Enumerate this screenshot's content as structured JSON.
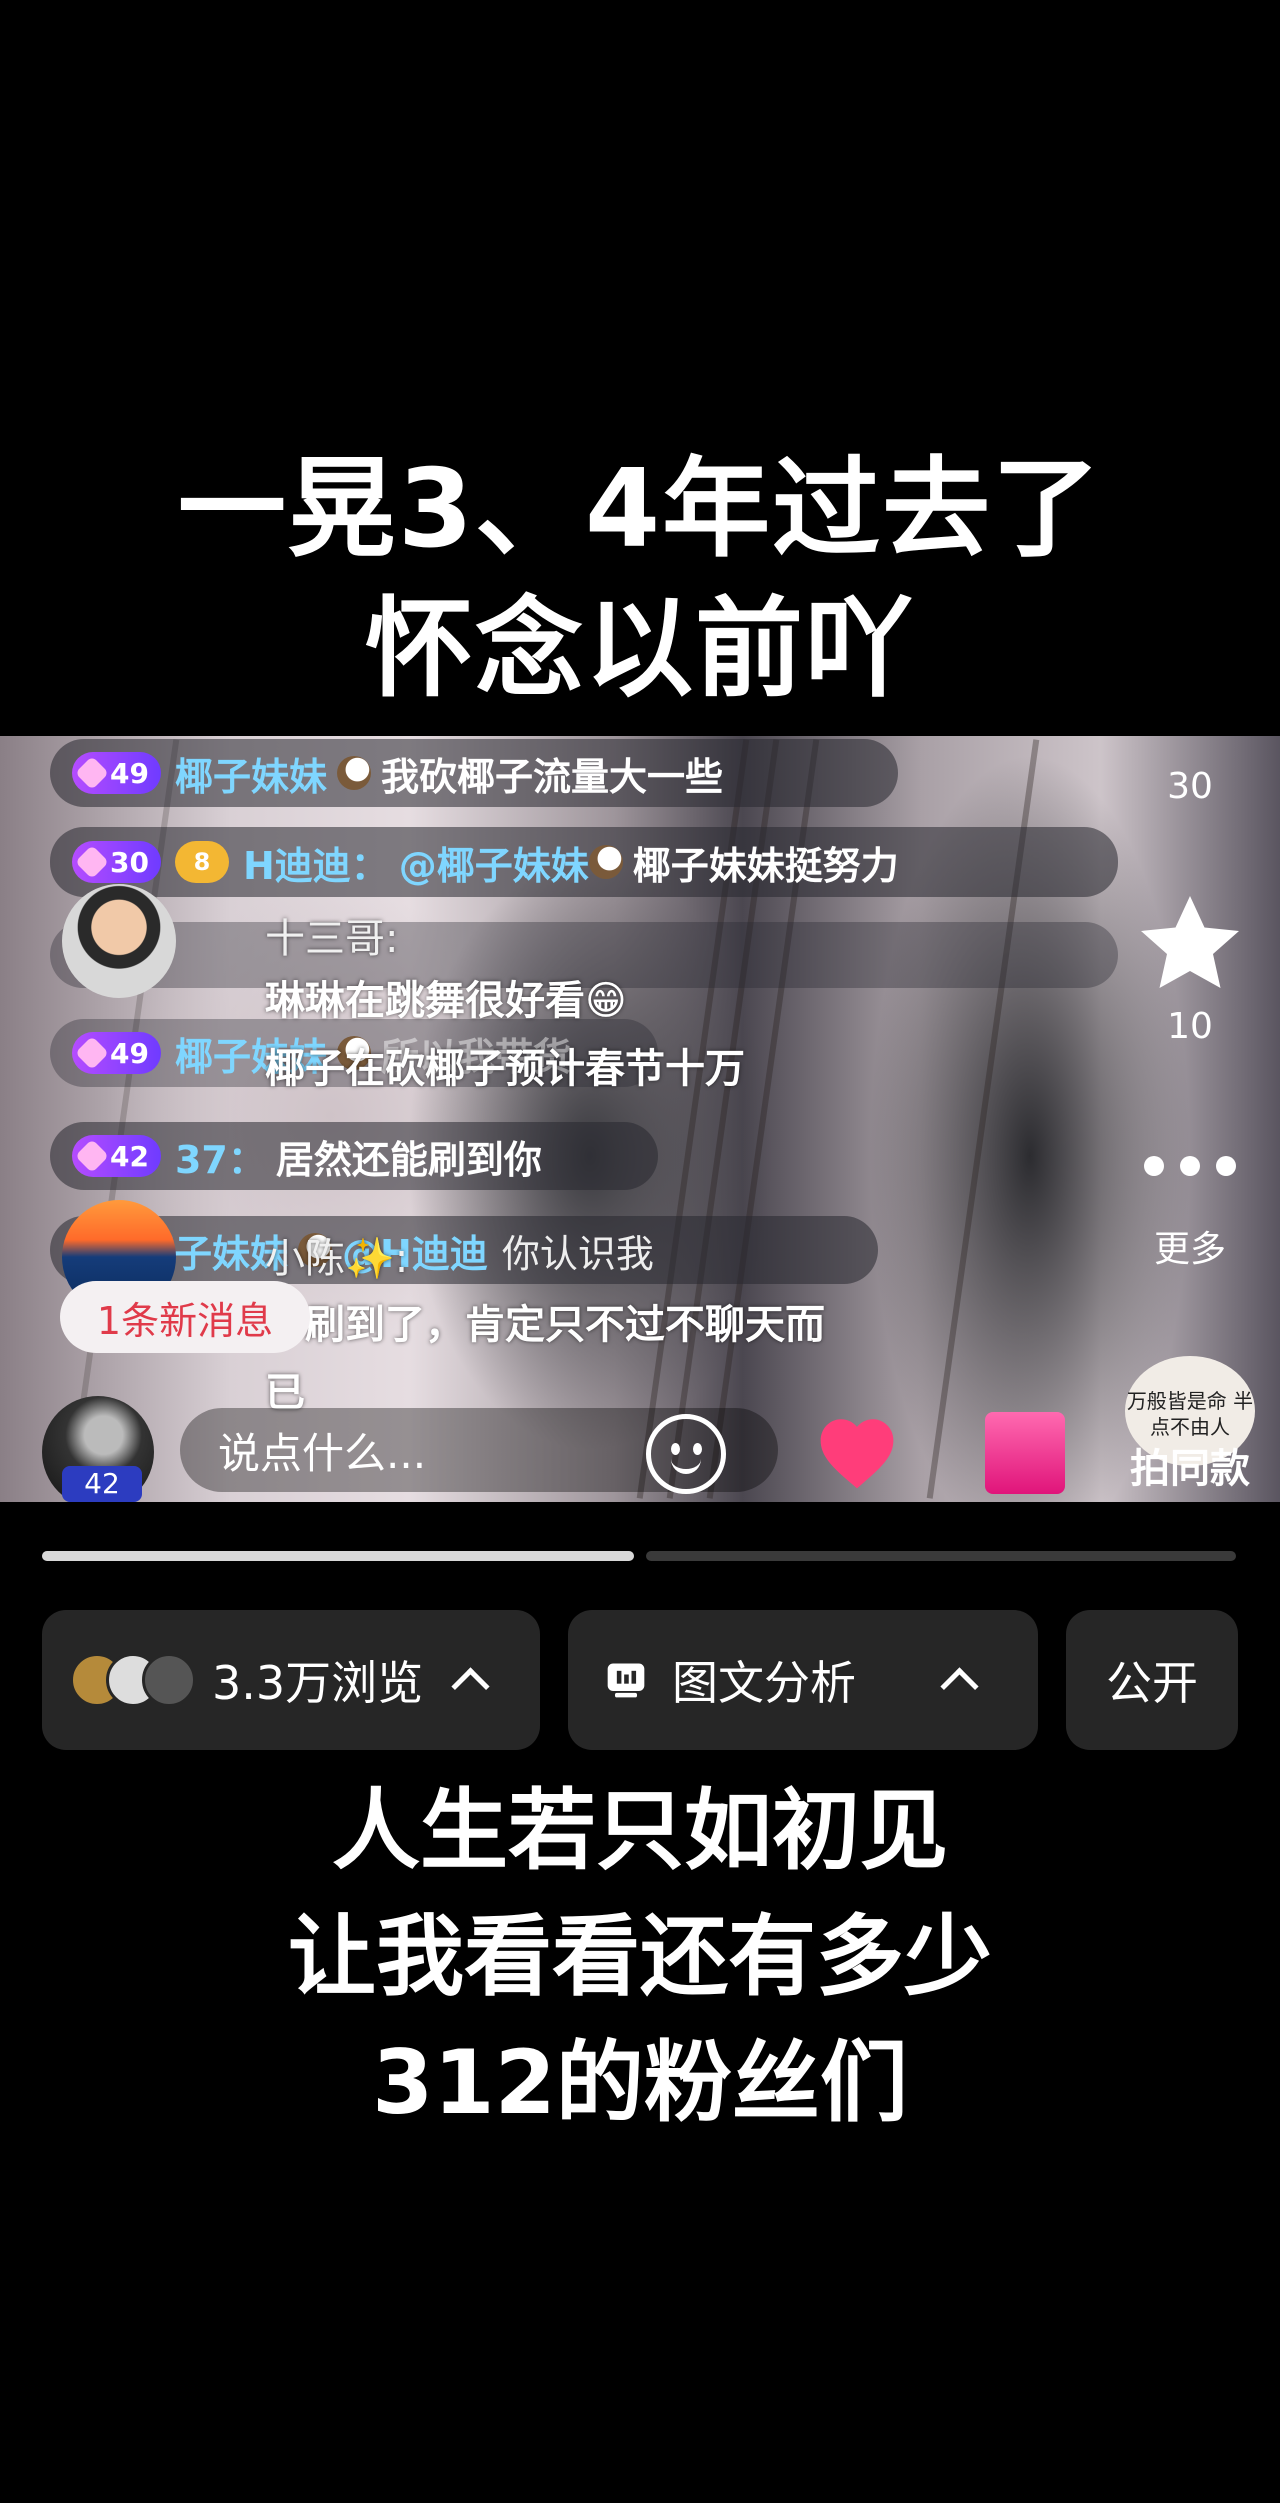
{
  "caption_top": {
    "line1": "一晃3、4年过去了",
    "line2": "怀念以前吖"
  },
  "live": {
    "side": {
      "share_count": "30",
      "star_count": "10",
      "more_label": "更多",
      "same_label": "拍同款",
      "same_art_text": "万般皆是命 半点不由人"
    },
    "chat": [
      {
        "level": "49",
        "name": "椰子妹妹",
        "text": "我砍椰子流量大一些"
      },
      {
        "level": "30",
        "fan_level": "8",
        "name": "H迪迪：",
        "mention": "@椰子妹妹",
        "text": "椰子妹妹挺努力"
      },
      {
        "level": "49",
        "name": "椰子妹妹",
        "text": "所以我带货"
      },
      {
        "level": "42",
        "name": "37：",
        "text": "居然还能刷到你"
      },
      {
        "level": "",
        "name": "椰子妹妹",
        "mention": "@H迪迪",
        "text": "你认识我"
      }
    ],
    "overlay_msgs": [
      {
        "name": "十三哥:",
        "lines": [
          "琳琳在跳舞很好看😁",
          "椰子在砍椰子预计春节十万"
        ]
      },
      {
        "name": "小陈✨:",
        "lines": [
          "都刷到了，肯定只不过不聊天而",
          "已"
        ]
      }
    ],
    "new_msg_notice": "1条新消息",
    "user_level": "42",
    "input_placeholder": "说点什么..."
  },
  "progress": {
    "segment1_fill": 1.0,
    "segment2_fill": 0.0
  },
  "bottom_bar": {
    "views_label": "3.3万浏览",
    "analysis_label": "图文分析",
    "public_label": "公开"
  },
  "caption_bottom": {
    "line1": "人生若只如初见",
    "line2": "让我看看还有多少",
    "line3": "312的粉丝们"
  }
}
